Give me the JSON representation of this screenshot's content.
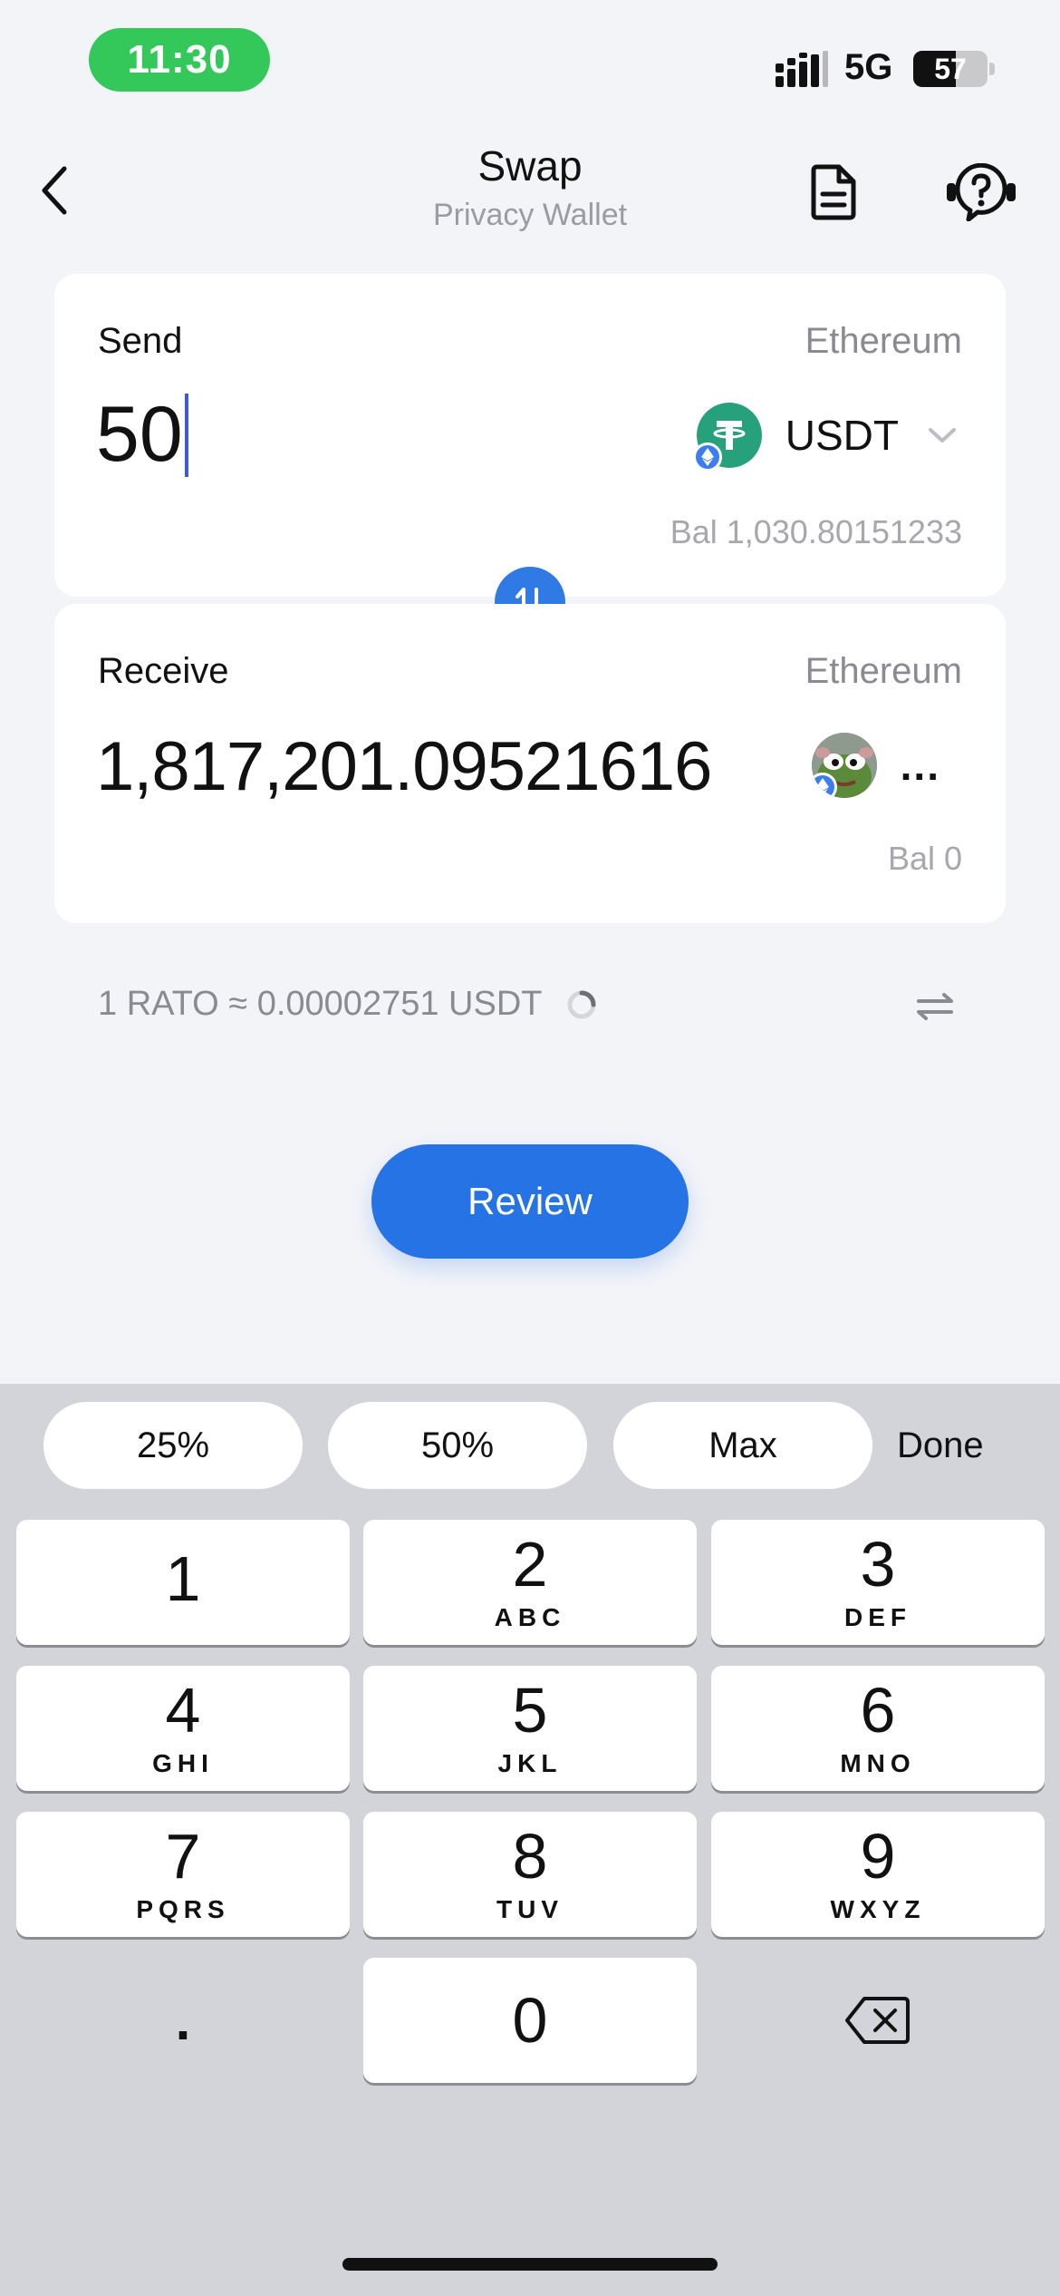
{
  "status_bar": {
    "time": "11:30",
    "network": "5G",
    "battery": "57",
    "battery_level": 0.57,
    "time_pill_color": "#34c759"
  },
  "header": {
    "title": "Swap",
    "subtitle": "Privacy Wallet",
    "icons": [
      "chevron-left-icon",
      "document-icon",
      "help-chat-icon"
    ]
  },
  "send": {
    "label": "Send",
    "network": "Ethereum",
    "amount": "50",
    "token_symbol": "USDT",
    "token_icon": "usdt-icon",
    "token_color": "#26a17b",
    "balance": "Bal 1,030.80151233"
  },
  "receive": {
    "label": "Receive",
    "network": "Ethereum",
    "amount": "1,817,201.09521616",
    "token_symbol": "...",
    "token_icon": "pepe-token-icon",
    "balance": "Bal 0"
  },
  "rate": {
    "text": "1 RATO ≈ 0.00002751 USDT"
  },
  "review_label": "Review",
  "accent_color": "#2673e6",
  "keyboard": {
    "accessory": [
      "25%",
      "50%",
      "Max"
    ],
    "done_label": "Done",
    "keys": [
      {
        "digit": "1",
        "letters": ""
      },
      {
        "digit": "2",
        "letters": "ABC"
      },
      {
        "digit": "3",
        "letters": "DEF"
      },
      {
        "digit": "4",
        "letters": "GHI"
      },
      {
        "digit": "5",
        "letters": "JKL"
      },
      {
        "digit": "6",
        "letters": "MNO"
      },
      {
        "digit": "7",
        "letters": "PQRS"
      },
      {
        "digit": "8",
        "letters": "TUV"
      },
      {
        "digit": "9",
        "letters": "WXYZ"
      }
    ],
    "decimal_key": ".",
    "zero_key": "0",
    "delete_icon": "backspace-icon"
  }
}
